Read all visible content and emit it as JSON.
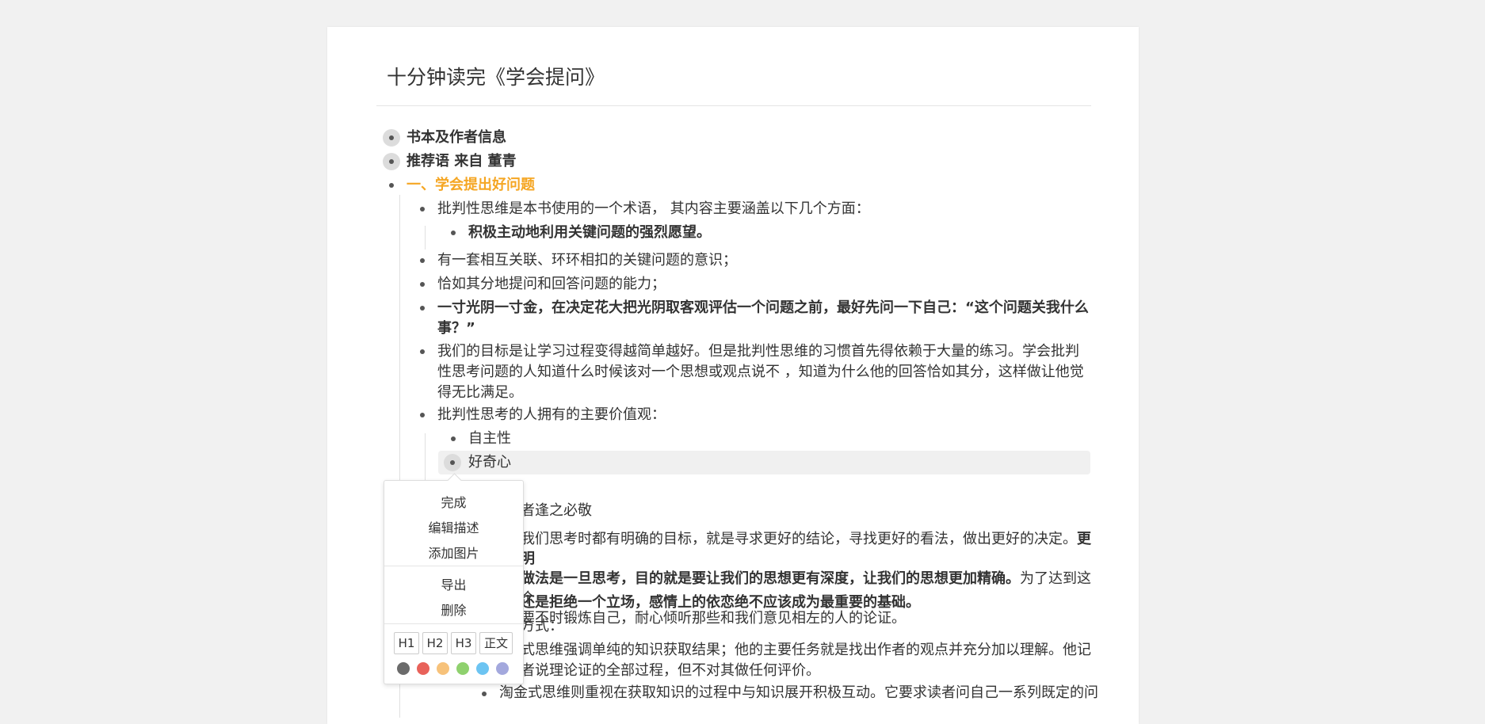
{
  "document": {
    "title": "十分钟读完《学会提问》"
  },
  "outline": [
    {
      "text": "书本及作者信息",
      "style": "bold",
      "collapsed": true
    },
    {
      "text": "推荐语 来自 董青",
      "style": "bold",
      "collapsed": true
    },
    {
      "text": "一、学会提出好问题",
      "style": "orange"
    },
    {
      "text": "批判性思维是本书使用的一个术语， 其内容主要涵盖以下几个方面："
    },
    {
      "text": "积极主动地利用关键问题的强烈愿望。",
      "style": "bold"
    },
    {
      "text": "有一套相互关联、环环相扣的关键问题的意识；"
    },
    {
      "text": "恰如其分地提问和回答问题的能力；"
    },
    {
      "text": "一寸光阴一寸金，在决定花大把光阴取客观评估一个问题之前，最好先问一下自己：“这个问题关我什么事？”",
      "style": "bold"
    },
    {
      "text": "我们的目标是让学习过程变得越简单越好。但是批判性思维的习惯首先得依赖于大量的练习。学会批判性思考问题的人知道什么时候该对一个思想或观点说不 ，知道为什么他的回答恰如其分，这样做让他觉得无比满足。"
    },
    {
      "text": "批判性思考的人拥有的主要价值观："
    },
    {
      "text": "自主性"
    },
    {
      "text": "好奇心",
      "selected": true,
      "collapsed": true
    },
    {
      "text": "者逢之必敬"
    },
    {
      "text_a": "我们思考时都有明确的目标，就是寻求更好的结论，寻找更好的看法，做出更好的决定。",
      "text_b": "更明",
      "text_c": "做法是一旦思考，目的就是要让我们的思想更有深度，让我们的思想更加精确。",
      "text_d": "为了达到这个",
      "text_e": "要不时锻炼自己，耐心倾听那些和我们意见相左的人的论证。"
    },
    {
      "text": "还是拒绝一个立场，感情上的依恋绝不应该成为最重要的基础。",
      "style": "bold"
    },
    {
      "text": "方式："
    },
    {
      "text_a": "式思维强调单纯的知识获取结果；他的主要任务就是找出作者的观点并充分加以理解。他记",
      "text_b": "者说理论证的全部过程，但不对其做任何评价。"
    },
    {
      "text": "淘金式思维则重视在获取知识的过程中与知识展开积极互动。它要求读者问自己一系列既定的问"
    }
  ],
  "context_menu": {
    "items": [
      "完成",
      "编辑描述",
      "添加图片",
      "导出",
      "删除"
    ],
    "heading_buttons": [
      "H1",
      "H2",
      "H3",
      "正文"
    ],
    "colors": [
      "#6b6b6b",
      "#e8625a",
      "#f7c27a",
      "#8fd16e",
      "#6cc4f2",
      "#a3a8dd"
    ]
  }
}
